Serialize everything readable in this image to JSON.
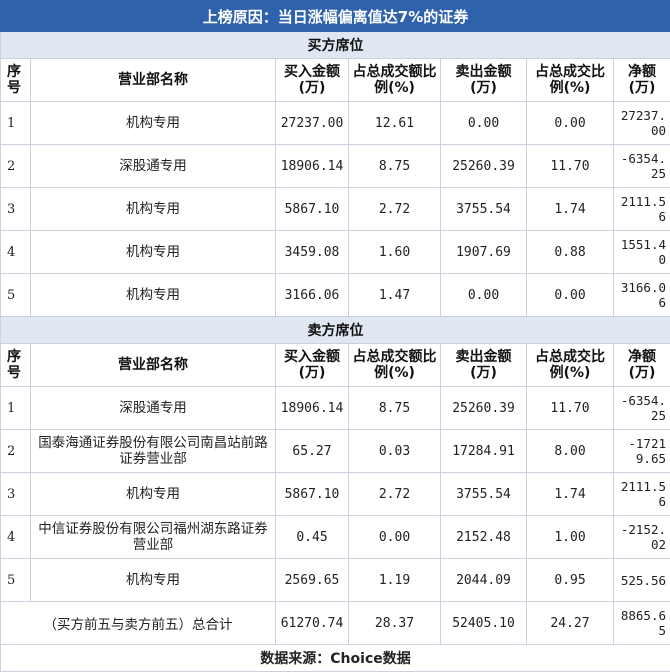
{
  "title": "上榜原因：当日涨幅偏离值达7%的证券",
  "buy_section": {
    "label": "买方席位"
  },
  "sell_section": {
    "label": "卖方席位"
  },
  "columns": {
    "idx": "序号",
    "name": "营业部名称",
    "buy_amount": "买入金额(万)",
    "buy_pct": "占总成交额比例(%)",
    "sell_amount": "卖出金额(万)",
    "sell_pct": "占总成交比例(%)",
    "net": "净额(万)"
  },
  "buy_rows": [
    {
      "idx": "1",
      "name": "机构专用",
      "buy_amount": "27237.00",
      "buy_pct": "12.61",
      "sell_amount": "0.00",
      "sell_pct": "0.00",
      "net": "27237.00"
    },
    {
      "idx": "2",
      "name": "深股通专用",
      "buy_amount": "18906.14",
      "buy_pct": "8.75",
      "sell_amount": "25260.39",
      "sell_pct": "11.70",
      "net": "-6354.25"
    },
    {
      "idx": "3",
      "name": "机构专用",
      "buy_amount": "5867.10",
      "buy_pct": "2.72",
      "sell_amount": "3755.54",
      "sell_pct": "1.74",
      "net": "2111.56"
    },
    {
      "idx": "4",
      "name": "机构专用",
      "buy_amount": "3459.08",
      "buy_pct": "1.60",
      "sell_amount": "1907.69",
      "sell_pct": "0.88",
      "net": "1551.40"
    },
    {
      "idx": "5",
      "name": "机构专用",
      "buy_amount": "3166.06",
      "buy_pct": "1.47",
      "sell_amount": "0.00",
      "sell_pct": "0.00",
      "net": "3166.06"
    }
  ],
  "sell_rows": [
    {
      "idx": "1",
      "name": "深股通专用",
      "buy_amount": "18906.14",
      "buy_pct": "8.75",
      "sell_amount": "25260.39",
      "sell_pct": "11.70",
      "net": "-6354.25"
    },
    {
      "idx": "2",
      "name": "国泰海通证券股份有限公司南昌站前路证券营业部",
      "buy_amount": "65.27",
      "buy_pct": "0.03",
      "sell_amount": "17284.91",
      "sell_pct": "8.00",
      "net": "-17219.65"
    },
    {
      "idx": "3",
      "name": "机构专用",
      "buy_amount": "5867.10",
      "buy_pct": "2.72",
      "sell_amount": "3755.54",
      "sell_pct": "1.74",
      "net": "2111.56"
    },
    {
      "idx": "4",
      "name": "中信证券股份有限公司福州湖东路证券营业部",
      "buy_amount": "0.45",
      "buy_pct": "0.00",
      "sell_amount": "2152.48",
      "sell_pct": "1.00",
      "net": "-2152.02"
    },
    {
      "idx": "5",
      "name": "机构专用",
      "buy_amount": "2569.65",
      "buy_pct": "1.19",
      "sell_amount": "2044.09",
      "sell_pct": "0.95",
      "net": "525.56"
    }
  ],
  "total": {
    "label": "（买方前五与卖方前五）总合计",
    "buy_amount": "61270.74",
    "buy_pct": "28.37",
    "sell_amount": "52405.10",
    "sell_pct": "24.27",
    "net": "8865.65"
  },
  "footer": "数据来源：Choice数据"
}
